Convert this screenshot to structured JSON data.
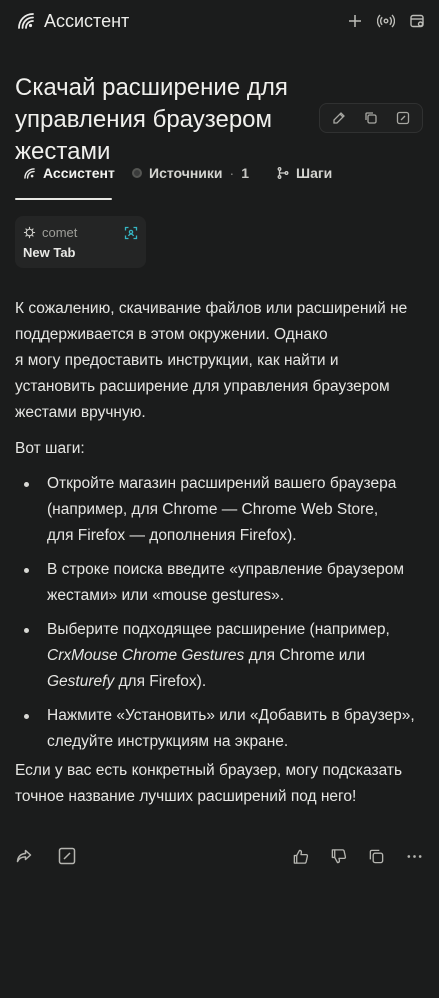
{
  "app": {
    "title": "Ассистент"
  },
  "query": {
    "title": "Скачай расширение для управления браузером жестами"
  },
  "tabs": [
    {
      "label": "Ассистент",
      "active": true
    },
    {
      "label": "Источники",
      "count_sep": "·",
      "count": "1"
    },
    {
      "label": "Шаги"
    }
  ],
  "source_card": {
    "source": "comet",
    "title": "New Tab"
  },
  "answer": {
    "intro_lines": [
      "К сожалению, скачивание файлов или расширений не",
      "поддерживается в этом окружении. Однако",
      "я могу предоставить инструкции, как найти и",
      "установить расширение для управления браузером",
      "жестами вручную."
    ],
    "steps_heading": "Вот шаги:",
    "steps": [
      {
        "line1": "Откройте магазин расширений вашего браузера",
        "line2": "(например, для Chrome — Chrome Web Store,",
        "line3": "для Firefox — дополнения Firefox)."
      },
      {
        "line1": "В строке поиска введите «управление браузером",
        "line2": "жестами» или «mouse gestures»."
      },
      {
        "line1_a": "Выберите подходящее расширение (например,",
        "ext1": "CrxMouse Chrome Gestures",
        "line2_mid": " для Chrome или",
        "ext2": "Gesturefy",
        "line3_tail": " для Firefox)."
      },
      {
        "line1": "Нажмите «Установить» или «Добавить в браузер»,",
        "line2": "следуйте инструкциям на экране."
      }
    ],
    "outro_lines": [
      "Если у вас есть конкретный браузер, могу подсказать",
      "точное название лучших расширений под него!"
    ]
  },
  "icons": {
    "logo": "perplexity-logo-icon",
    "accent": "#35b6c4"
  }
}
